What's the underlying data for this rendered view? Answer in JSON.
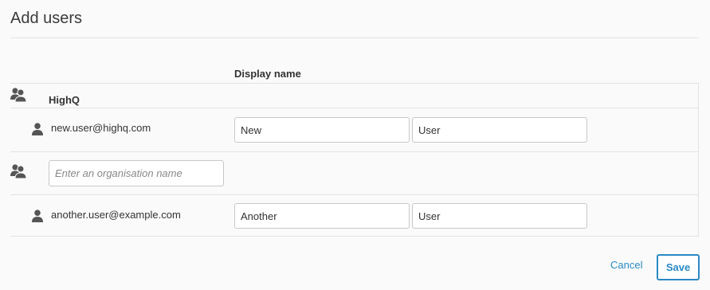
{
  "dialog": {
    "title": "Add users",
    "column_header": "Display name"
  },
  "groups": [
    {
      "icon": "group-icon",
      "organisation": "HighQ",
      "users": [
        {
          "icon": "user-icon",
          "email": "new.user@highq.com",
          "first_name": "New",
          "last_name": "User"
        }
      ]
    },
    {
      "icon": "group-icon",
      "organisation_placeholder": "Enter an organisation name",
      "organisation_value": "",
      "users": [
        {
          "icon": "user-icon",
          "email": "another.user@example.com",
          "first_name": "Another",
          "last_name": "User"
        }
      ]
    }
  ],
  "actions": {
    "cancel_label": "Cancel",
    "save_label": "Save"
  },
  "colors": {
    "accent": "#2a8ac4",
    "border": "#c8c8c8",
    "divider": "#e2e2e2",
    "background": "#fafafa",
    "icon": "#555555"
  }
}
